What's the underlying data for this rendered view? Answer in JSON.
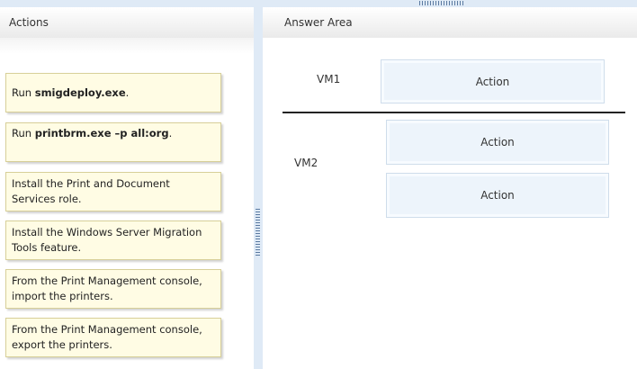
{
  "actions_panel": {
    "title": "Actions",
    "items": [
      {
        "prefix": "Run ",
        "bold": "smigdeploy.exe",
        "suffix": "."
      },
      {
        "prefix": "Run ",
        "bold": "printbrm.exe –p all:org",
        "suffix": "."
      },
      {
        "prefix": "Install the Print and Document Services role.",
        "bold": "",
        "suffix": ""
      },
      {
        "prefix": "Install the Windows Server Migration Tools feature.",
        "bold": "",
        "suffix": ""
      },
      {
        "prefix": "From the Print Management console, import the printers.",
        "bold": "",
        "suffix": ""
      },
      {
        "prefix": "From the Print Management console, export the printers.",
        "bold": "",
        "suffix": ""
      }
    ]
  },
  "answer_area": {
    "title": "Answer Area",
    "vm1": {
      "label": "VM1",
      "slots": [
        "Action"
      ]
    },
    "vm2": {
      "label": "VM2",
      "slots": [
        "Action",
        "Action"
      ]
    }
  }
}
